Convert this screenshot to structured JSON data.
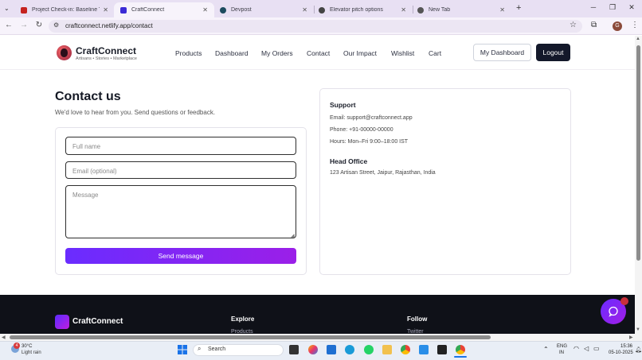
{
  "browser": {
    "tabs": [
      {
        "title": "Project Check-in: Baseline Tech",
        "favicon_color": "#c5221f"
      },
      {
        "title": "CraftConnect",
        "favicon_color": "#3b2bd6"
      },
      {
        "title": "Devpost",
        "favicon_color": "#1c4b5f"
      },
      {
        "title": "Elevator pitch options",
        "favicon_color": "#444444"
      },
      {
        "title": "New Tab",
        "favicon_color": "#555555"
      }
    ],
    "url": "craftconnect.netlify.app/contact",
    "profile_initial": "G"
  },
  "site": {
    "brand": "CraftConnect",
    "tagline": "Artisans • Stories • Marketplace",
    "nav": [
      "Products",
      "Dashboard",
      "My Orders",
      "Contact",
      "Our Impact",
      "Wishlist",
      "Cart"
    ],
    "my_dashboard": "My Dashboard",
    "logout": "Logout"
  },
  "contact": {
    "title": "Contact us",
    "subtitle": "We'd love to hear from you. Send questions or feedback.",
    "name_placeholder": "Full name",
    "email_placeholder": "Email (optional)",
    "message_placeholder": "Message",
    "send_label": "Send message"
  },
  "support": {
    "heading": "Support",
    "email": "Email: support@craftconnect.app",
    "phone": "Phone: +91-00000-00000",
    "hours": "Hours: Mon–Fri 9:00–18:00 IST",
    "office_heading": "Head Office",
    "address": "123 Artisan Street, Jaipur, Rajasthan, India"
  },
  "footer": {
    "brand": "CraftConnect",
    "explore_heading": "Explore",
    "explore_link": "Products",
    "follow_heading": "Follow",
    "follow_link": "Twitter",
    "chat_badge": ""
  },
  "taskbar": {
    "weather_badge": "4",
    "temperature": "30°C",
    "condition": "Light rain",
    "search_placeholder": "Search",
    "lang": "ENG",
    "region": "IN",
    "time": "15:36",
    "date": "05-10-2025"
  },
  "colors": {
    "accent_gradient_start": "#6a2cff",
    "accent_gradient_end": "#9b1fe8",
    "logout_bg": "#13182a",
    "footer_bg": "#0f1118"
  }
}
